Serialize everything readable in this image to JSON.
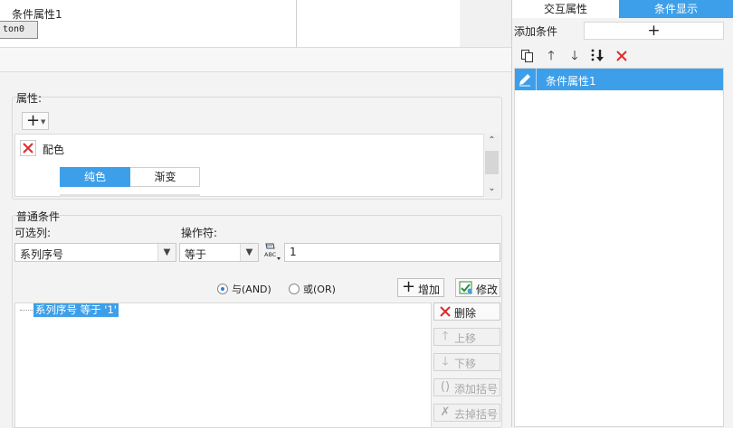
{
  "canvas": {
    "button_text": "ton0"
  },
  "dialog": {
    "title": "条件属性1"
  },
  "properties": {
    "group_label": "属性:",
    "items": [
      {
        "name": "配色"
      }
    ],
    "fill_modes": [
      "纯色",
      "渐变"
    ],
    "selected_fill_mode": "纯色"
  },
  "conditions": {
    "group_label": "普通条件",
    "column_label": "可选列:",
    "column_value": "系列序号",
    "operator_label": "操作符:",
    "operator_value": "等于",
    "value": "1",
    "logic": {
      "and_label": "与(AND)",
      "or_label": "或(OR)",
      "selected": "and"
    },
    "add_label": "增加",
    "modify_label": "修改",
    "tree": [
      "系列序号 等于 '1'"
    ],
    "side_buttons": {
      "delete": "删除",
      "move_up": "上移",
      "move_down": "下移",
      "add_bracket": "添加括号",
      "remove_bracket": "去掉括号"
    }
  },
  "right_panel": {
    "tabs": [
      {
        "label": "交互属性",
        "active": false
      },
      {
        "label": "条件显示",
        "active": true
      }
    ],
    "add_condition_label": "添加条件",
    "add_condition_button": "+",
    "list": [
      {
        "label": "条件属性1",
        "selected": true
      }
    ]
  },
  "colors": {
    "accent": "#3d9fe9",
    "delete_red": "#e02a2a"
  }
}
